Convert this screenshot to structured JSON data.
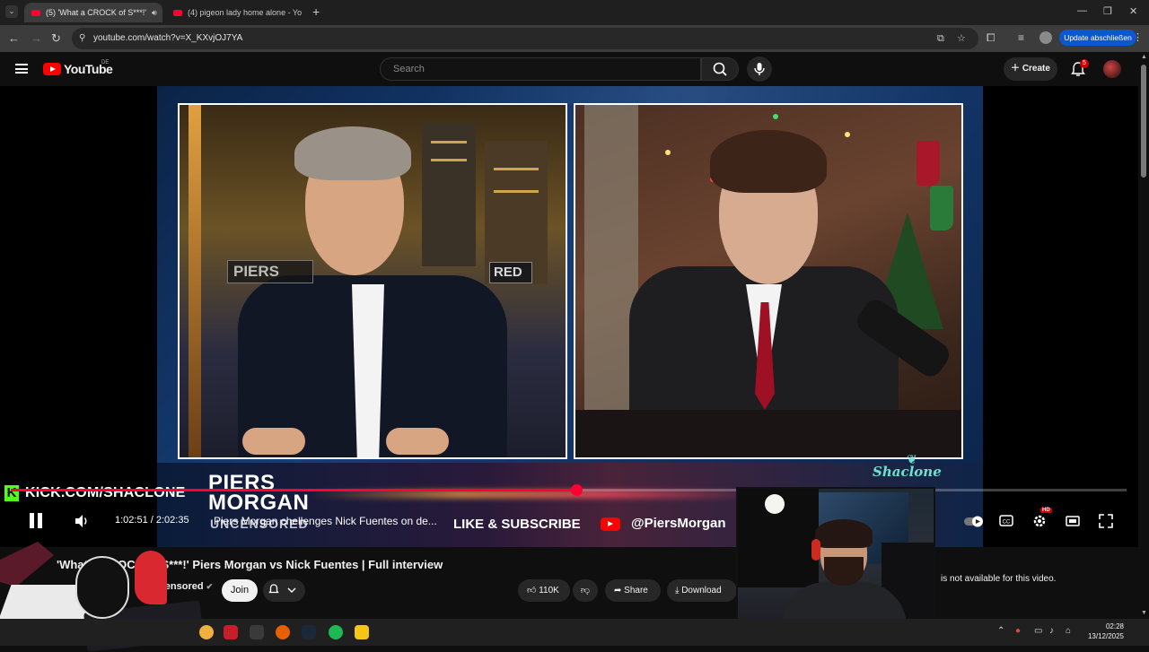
{
  "browser": {
    "tabs": [
      {
        "label": "(5) 'What a CROCK of S***!'",
        "active": true
      },
      {
        "label": "(4) pigeon lady home alone - Yo",
        "active": false
      }
    ],
    "new_tab_label": "+",
    "url": "youtube.com/watch?v=X_KXvjOJ7YA",
    "update_button": "Update abschließen",
    "icons": [
      "back-icon",
      "forward-icon",
      "reload-icon",
      "site-info-icon",
      "install-icon",
      "star-icon",
      "extensions-icon",
      "media-icon",
      "profile-icon",
      "menu-dots-icon"
    ]
  },
  "youtube": {
    "logo_text": "YouTube",
    "region": "DE",
    "search_placeholder": "Search",
    "create_label": "Create",
    "notification_count": "5"
  },
  "video": {
    "lower_third": {
      "show_line1": "PIERS",
      "show_line2": "MORGAN",
      "show_line3": "UNCENSORED",
      "cta": "LIKE & SUBSCRIBE",
      "handle": "@PiersMorgan"
    },
    "set_plate_left": "PIERS",
    "set_plate_right": "RED",
    "watermark": "Shaclone"
  },
  "overlay": {
    "kick_logo": "K",
    "kick_url": "KICK.COM/SHACLONE"
  },
  "player": {
    "progress": 0.507,
    "current_time": "1:02:51",
    "duration": "2:02:35",
    "time_separator": " / ",
    "chapter": "Piers Morgan chellenges Nick Fuentes on de...",
    "hd_badge": "HD"
  },
  "details": {
    "title": "'What a CROCK of S***!' Piers Morgan vs Nick Fuentes | Full interview",
    "channel": "Uncensored",
    "join_label": "Join",
    "likes": "110K",
    "share_label": "Share",
    "download_label": "Download",
    "side_message": "is not available for this video."
  },
  "taskbar": {
    "time": "02:28",
    "date": "13/12/2025",
    "apps": [
      "app-red-icon",
      "app-figure-icon",
      "firefox-icon",
      "steam-icon",
      "spotify-icon",
      "app-yellow-icon"
    ]
  },
  "colors": {
    "accent_red": "#ff0033",
    "kick_green": "#53fc18",
    "chrome_blue": "#0b57d0"
  }
}
